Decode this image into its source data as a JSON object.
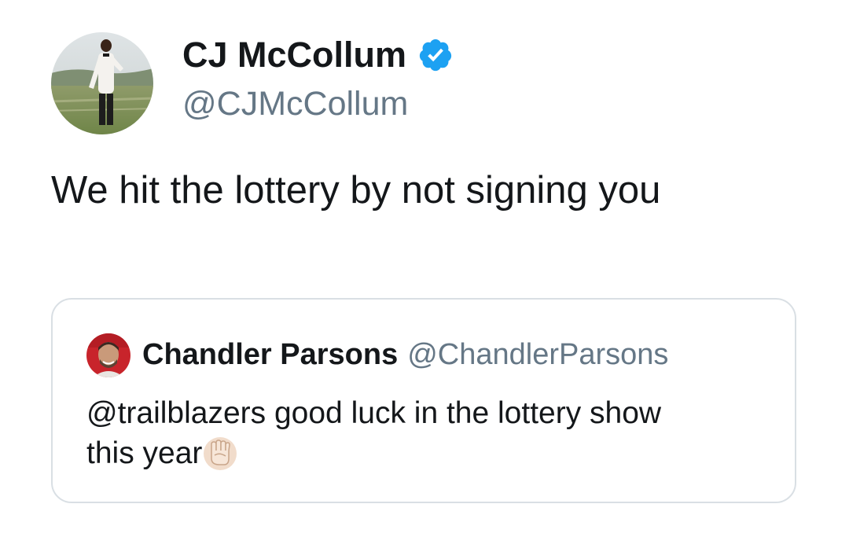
{
  "tweet": {
    "author_name": "CJ McCollum",
    "author_handle": "@CJMcCollum",
    "verified_icon": "verified-badge-icon",
    "text": "We hit the lottery by not signing you"
  },
  "quoted_tweet": {
    "author_name": "Chandler Parsons",
    "author_handle": "@ChandlerParsons",
    "text_line1": "@trailblazers good luck in the lottery show",
    "text_line2": "this year",
    "emoji_icon": "raised-fist-light-skin-icon"
  },
  "colors": {
    "verified_blue": "#1da1f2",
    "secondary_text": "#657786",
    "card_border": "#d9dfe4"
  }
}
